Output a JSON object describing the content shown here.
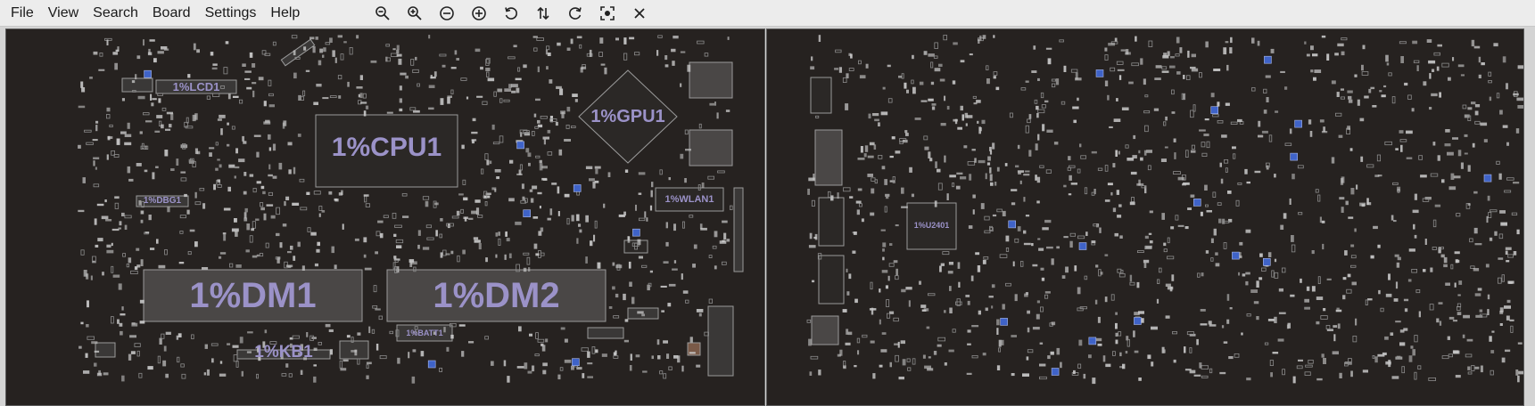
{
  "menu": {
    "items": [
      "File",
      "View",
      "Search",
      "Board",
      "Settings",
      "Help"
    ]
  },
  "toolbar": {
    "tools": [
      {
        "name": "zoom-out-icon"
      },
      {
        "name": "zoom-in-icon"
      },
      {
        "name": "zoom-out-circle-icon"
      },
      {
        "name": "zoom-in-circle-icon"
      },
      {
        "name": "rotate-left-icon"
      },
      {
        "name": "flip-icon"
      },
      {
        "name": "rotate-right-icon"
      },
      {
        "name": "zoom-fit-icon"
      },
      {
        "name": "close-icon"
      }
    ]
  },
  "board": {
    "colors": {
      "background": "#262220",
      "component_outline": "#8c8c8c",
      "pad_fill": "#c8c8c8",
      "highlight_pad": "#3f63c8",
      "label": "#9b92c8"
    },
    "top_labels": {
      "lcd": "1%LCD1",
      "cpu": "1%CPU1",
      "gpu": "1%GPU1",
      "dbg": "1%DBG1",
      "wlan": "1%WLAN1",
      "dm1": "1%DM1",
      "dm2": "1%DM2",
      "batt": "1%BATT1",
      "kb": "1%KB1"
    },
    "bottom_labels": {
      "u2401": "1%U2401"
    }
  }
}
